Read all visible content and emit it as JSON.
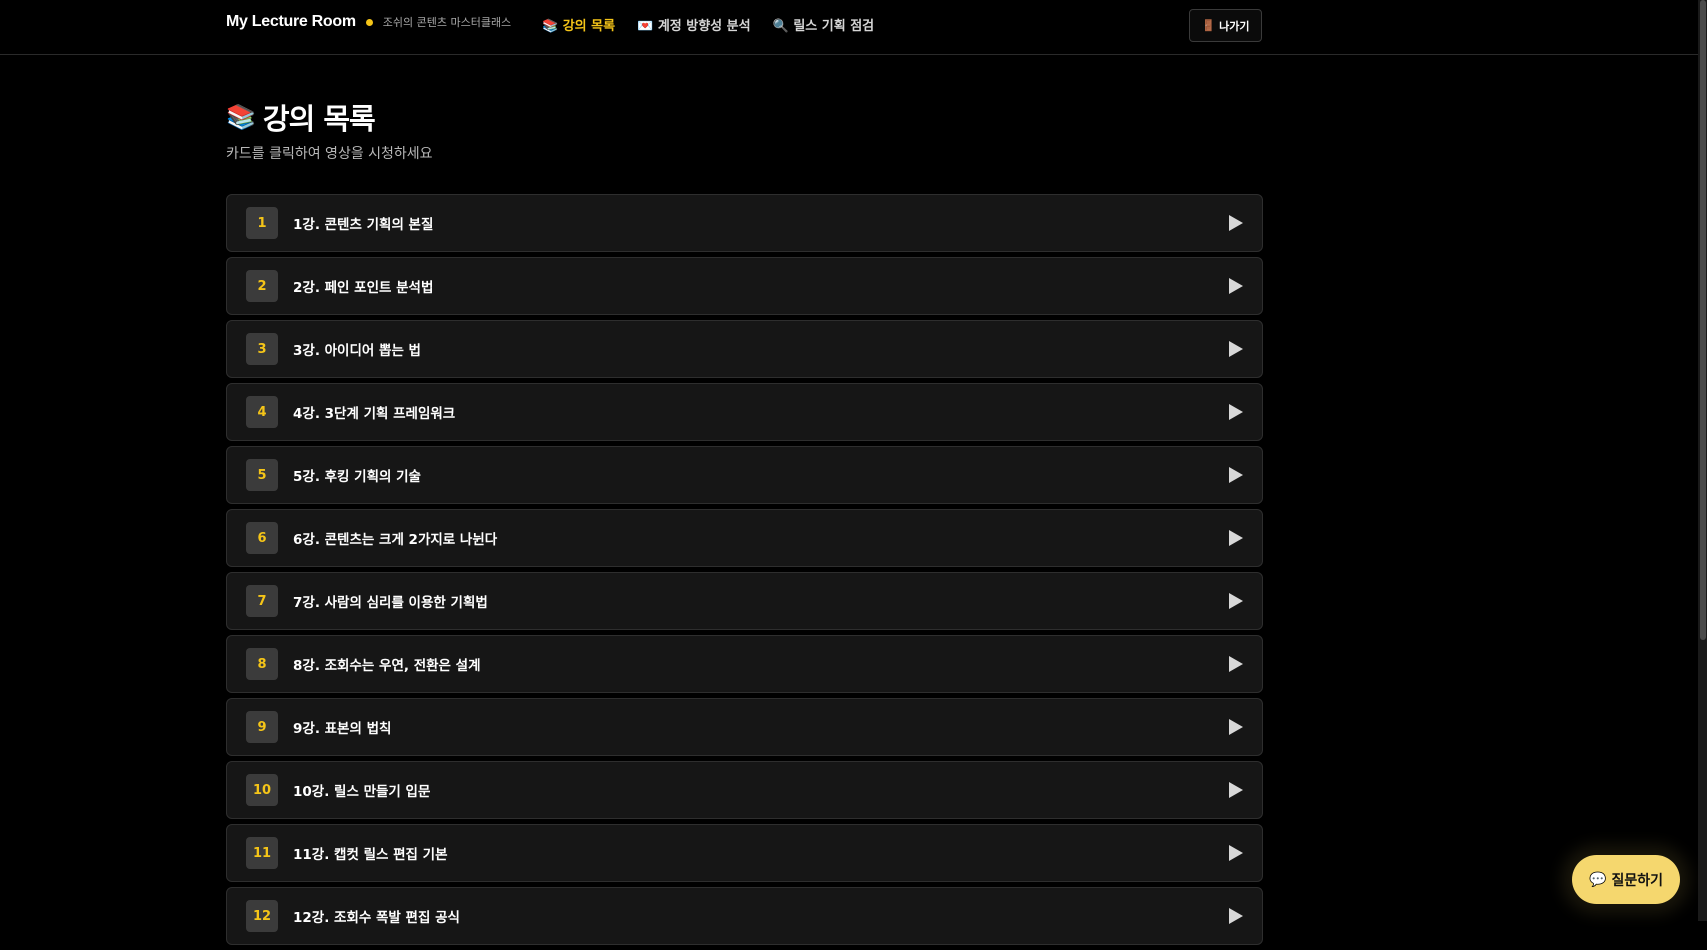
{
  "header": {
    "brand": "My Lecture Room",
    "subtitle": "조쉬의 콘텐츠 마스터클래스",
    "nav": [
      {
        "icon": "📚",
        "label": "강의 목록",
        "active": true
      },
      {
        "icon": "💌",
        "label": "계정 방향성 분석",
        "active": false
      },
      {
        "icon": "🔍",
        "label": "릴스 기획 점검",
        "active": false
      }
    ],
    "exit_icon": "🚪",
    "exit_label": "나가기"
  },
  "page": {
    "title_icon": "📚",
    "title": "강의 목록",
    "subtitle": "카드를 클릭하여 영상을 시청하세요"
  },
  "lectures": [
    {
      "number": "1",
      "title": "1강. 콘텐츠 기획의 본질"
    },
    {
      "number": "2",
      "title": "2강. 페인 포인트 분석법"
    },
    {
      "number": "3",
      "title": "3강. 아이디어 뽑는 법"
    },
    {
      "number": "4",
      "title": "4강. 3단계 기획 프레임워크"
    },
    {
      "number": "5",
      "title": "5강. 후킹 기획의 기술"
    },
    {
      "number": "6",
      "title": "6강. 콘텐츠는 크게 2가지로 나뉜다"
    },
    {
      "number": "7",
      "title": "7강. 사람의 심리를 이용한 기획법"
    },
    {
      "number": "8",
      "title": "8강. 조회수는 우연, 전환은 설계"
    },
    {
      "number": "9",
      "title": "9강. 표본의 법칙"
    },
    {
      "number": "10",
      "title": "10강. 릴스 만들기 입문"
    },
    {
      "number": "11",
      "title": "11강. 캡컷 릴스 편집 기본"
    },
    {
      "number": "12",
      "title": "12강. 조회수 폭발 편집 공식"
    }
  ],
  "ask": {
    "icon": "💬",
    "label": "질문하기"
  },
  "colors": {
    "accent": "#f5c518",
    "background": "#000000",
    "card": "#161616"
  }
}
